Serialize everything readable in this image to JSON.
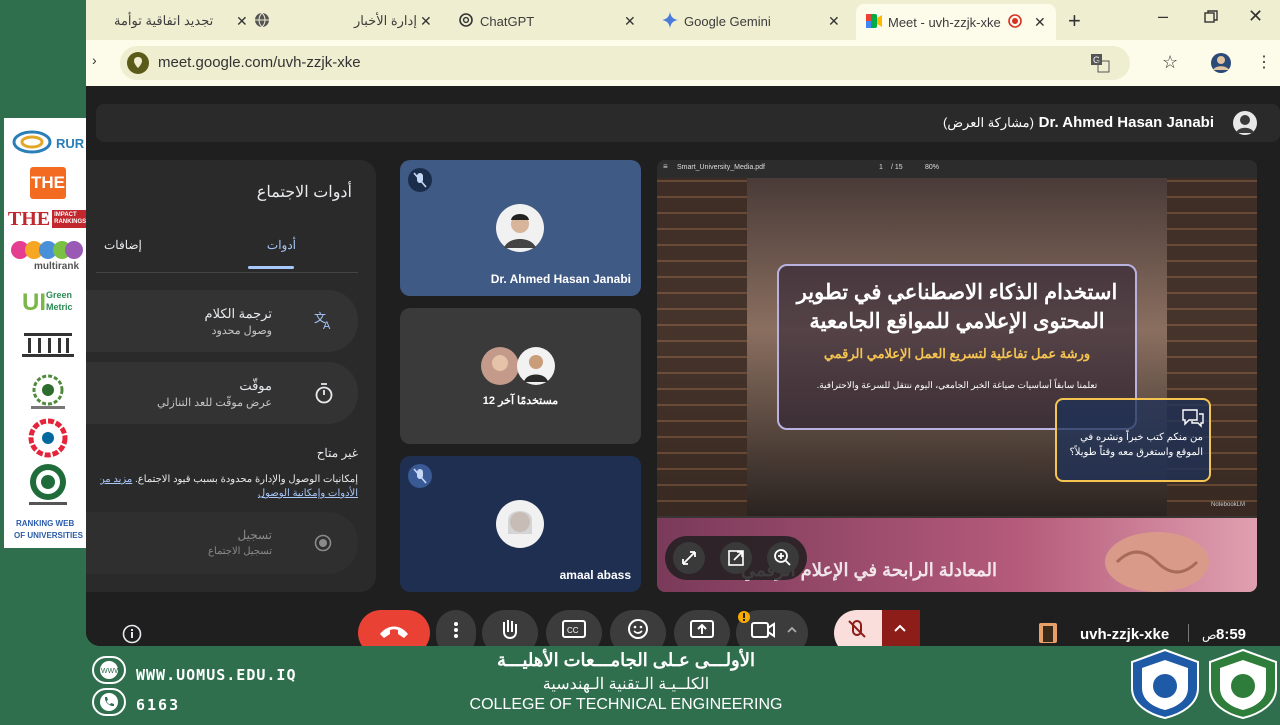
{
  "browser": {
    "tabs": [
      {
        "title": "تجديد اتفاقية توأمة",
        "icon": "globe-icon"
      },
      {
        "title": "إدارة الأخبار",
        "icon": "globe-icon"
      },
      {
        "title": "ChatGPT",
        "icon": "chatgpt-icon"
      },
      {
        "title": "Google Gemini",
        "icon": "gemini-icon"
      },
      {
        "title": "Meet - uvh-zzjk-xke",
        "icon": "meet-icon"
      }
    ],
    "url": "meet.google.com/uvh-zzjk-xke"
  },
  "meet": {
    "presenter_name": "Dr. Ahmed Hasan Janabi",
    "presenter_status": "(مشاركة العرض)",
    "tools_panel": {
      "title": "أدوات الاجتماع",
      "tabs": [
        "أدوات",
        "إضافات"
      ],
      "items": [
        {
          "title": "ترجمة الكلام",
          "subtitle": "وصول محدود"
        },
        {
          "title": "موقّت",
          "subtitle": "عرض موقّت للعد التنازلي"
        }
      ],
      "unavailable_heading": "غير متاح",
      "notice": "إمكانيات الوصول والإدارة محدودة بسبب قيود الاجتماع.",
      "notice_link1": "مزيد من المعلومات",
      "notice_link2": "الأدوات وإمكانية الوصول",
      "record_title": "تسجيل",
      "record_subtitle": "تسجيل الاجتماع"
    },
    "tiles": [
      {
        "name": "Dr. Ahmed Hasan Janabi"
      },
      {
        "name": "12 مستخدمًا آخر"
      },
      {
        "name": "amaal abass"
      }
    ],
    "slide": {
      "pdf_name": "Smart_University_Media.pdf",
      "page": "1",
      "total": "/ 15",
      "zoom": "80%",
      "title": "استخدام الذكاء الاصطناعي في تطوير المحتوى الإعلامي للمواقع الجامعية",
      "subtitle": "ورشة عمل تفاعلية لتسريع العمل الإعلامي الرقمي",
      "description": "تعلمنا سابقاً أساسيات صياغة الخبر الجامعي، اليوم ننتقل للسرعة والاحترافية.",
      "bubble": "من منكم كتب خبراً ونشره في الموقع واستغرق معه وقتاً طويلاً؟",
      "watermark": "NotebookLM",
      "next_title": "المعادلة الرابحة في الإعلام الرقمي"
    },
    "meeting_code": "uvh-zzjk-xke",
    "time": "8:59",
    "am_pm": "ص"
  },
  "banner": {
    "website": "WWW.UOMUS.EDU.IQ",
    "phone": "6163",
    "line1": "الأولـــى عـلى الجامـــعات الأهليـــة",
    "line2": "الكلــيـة الـتقنية الـهندسية",
    "line3": "COLLEGE OF TECHNICAL ENGINEERING"
  },
  "logos": [
    "RUR",
    "THE",
    "THE IMPACT RANKINGS",
    "multirank",
    "UI Green Metric",
    "ARAB UNIVERSITIES",
    "SDG",
    "Federation of Arab Engineers",
    "RANKING WEB OF UNIVERSITIES"
  ],
  "colors": {
    "frame_green": "#2f6f4e",
    "meet_bg": "#1f1f1f",
    "tile_blue": "#3f5a85",
    "end_call_red": "#e94235"
  }
}
